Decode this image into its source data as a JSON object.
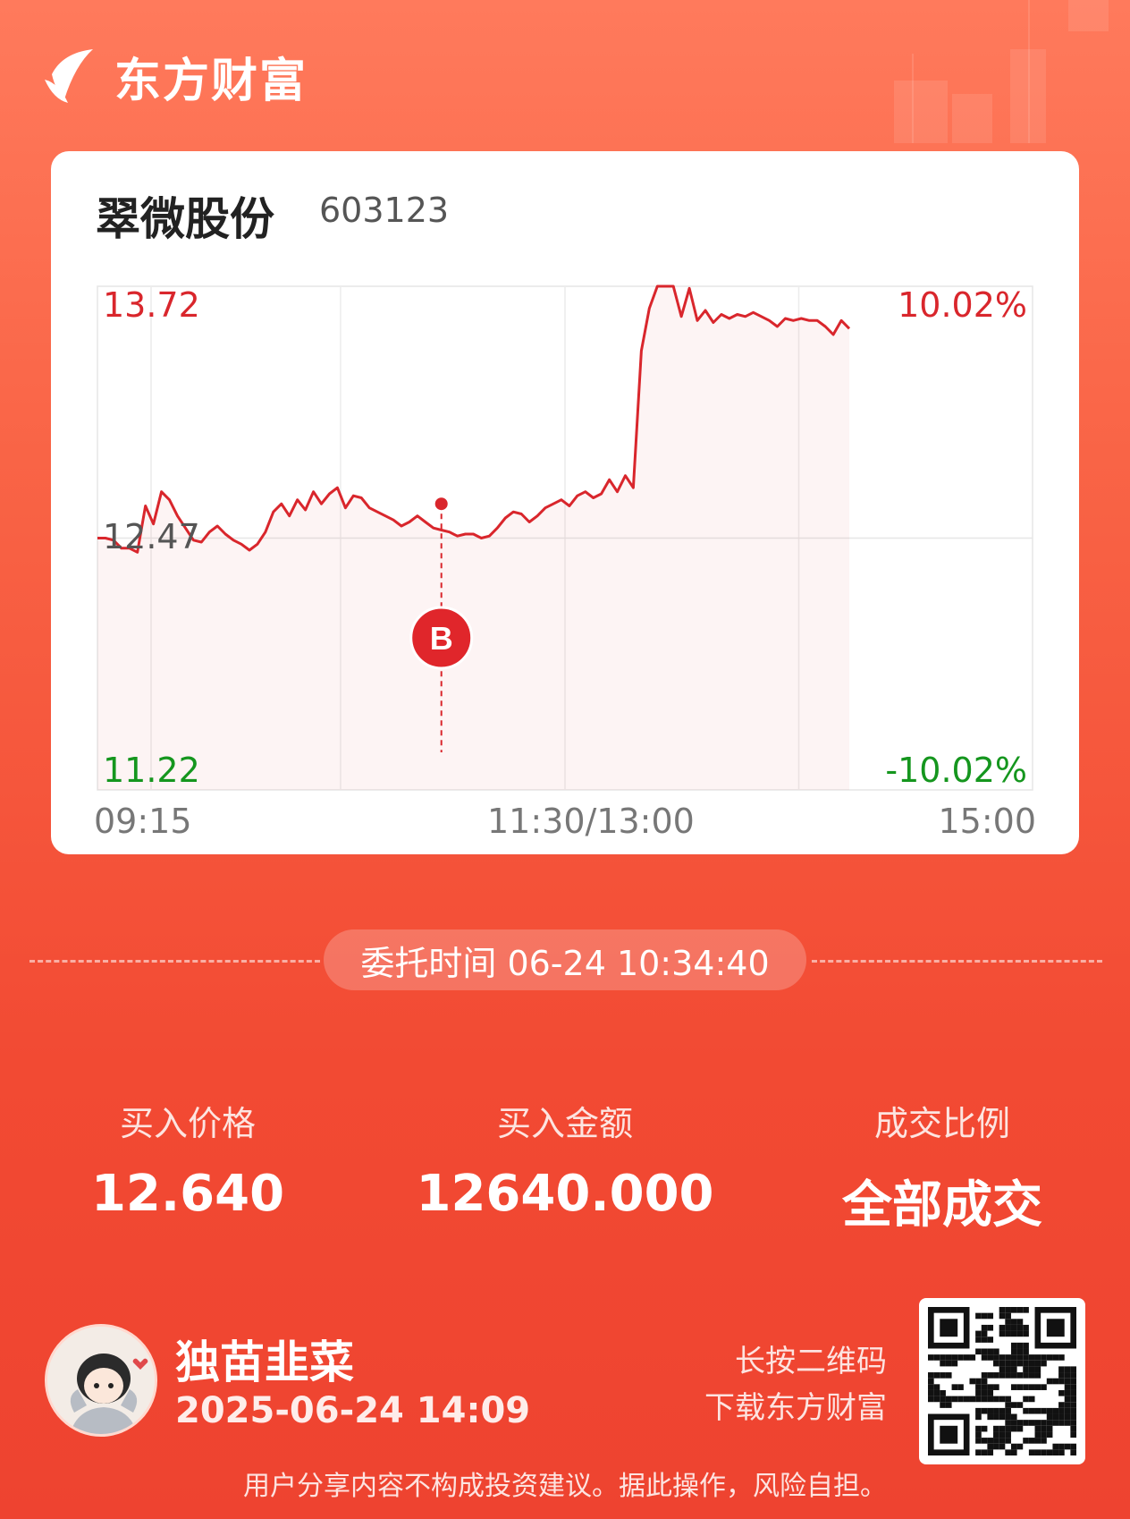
{
  "brand": {
    "name": "东方财富"
  },
  "stock": {
    "name": "翠微股份",
    "code": "603123"
  },
  "chart_data": {
    "type": "line",
    "title": "",
    "x_ticks": [
      "09:15",
      "11:30/13:00",
      "15:00"
    ],
    "y_labels": {
      "high": "13.72",
      "mid": "12.47",
      "low": "11.22"
    },
    "pct_labels": {
      "high": "10.02%",
      "low": "-10.02%"
    },
    "ylim": [
      11.22,
      13.72
    ],
    "grid": true,
    "series": [
      {
        "values": [
          12.47,
          12.47,
          12.46,
          12.42,
          12.42,
          12.4,
          12.63,
          12.54,
          12.7,
          12.66,
          12.58,
          12.52,
          12.46,
          12.45,
          12.5,
          12.53,
          12.49,
          12.46,
          12.44,
          12.41,
          12.44,
          12.5,
          12.6,
          12.64,
          12.58,
          12.66,
          12.61,
          12.7,
          12.64,
          12.69,
          12.72,
          12.62,
          12.68,
          12.67,
          12.62,
          12.6,
          12.58,
          12.56,
          12.53,
          12.55,
          12.58,
          12.55,
          12.52,
          12.51,
          12.5,
          12.48,
          12.49,
          12.49,
          12.47,
          12.48,
          12.52,
          12.57,
          12.6,
          12.59,
          12.55,
          12.58,
          12.62,
          12.64,
          12.66,
          12.63,
          12.68,
          12.7,
          12.67,
          12.69,
          12.76,
          12.7,
          12.78,
          12.72,
          13.4,
          13.61,
          13.72,
          13.72,
          13.72,
          13.57,
          13.71,
          13.55,
          13.6,
          13.54,
          13.58,
          13.56,
          13.58,
          13.57,
          13.59,
          13.57,
          13.55,
          13.52,
          13.56,
          13.55,
          13.56,
          13.55,
          13.55,
          13.52,
          13.48,
          13.55,
          13.51
        ]
      }
    ],
    "marker": {
      "label": "B",
      "price": 12.64,
      "time": "10:34:40"
    }
  },
  "order": {
    "time_label": "委托时间 06-24 10:34:40"
  },
  "stats": [
    {
      "label": "买入价格",
      "value": "12.640"
    },
    {
      "label": "买入金额",
      "value": "12640.000"
    },
    {
      "label": "成交比例",
      "value": "全部成交"
    }
  ],
  "user": {
    "name": "独苗韭菜",
    "time": "2025-06-24 14:09"
  },
  "qr": {
    "hint_line1": "长按二维码",
    "hint_line2": "下载东方财富"
  },
  "disclaimer": "用户分享内容不构成投资建议。据此操作，风险自担。",
  "colors": {
    "up": "#d9262c",
    "down": "#15961e",
    "bg": "#f24a33"
  }
}
